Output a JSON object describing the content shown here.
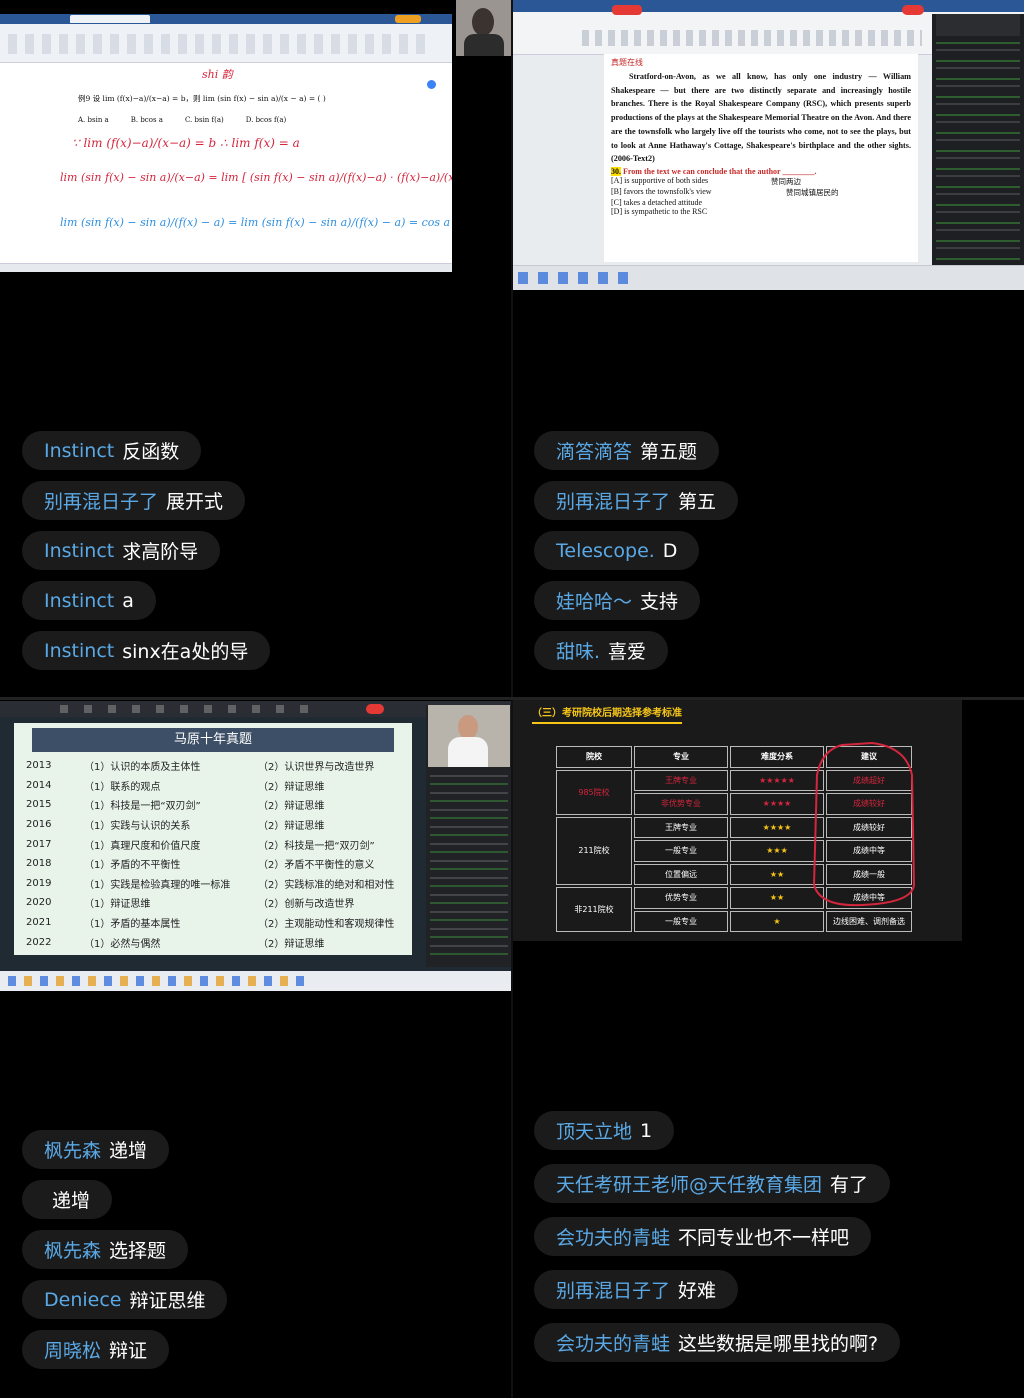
{
  "panels": [
    {
      "chat": [
        {
          "user": "Instinct",
          "msg": "反函数"
        },
        {
          "user": "别再混日子了",
          "msg": "展开式"
        },
        {
          "user": "Instinct",
          "msg": "求高阶导"
        },
        {
          "user": "Instinct",
          "msg": "a"
        },
        {
          "user": "Instinct",
          "msg": "sinx在a处的导"
        }
      ]
    },
    {
      "chat": [
        {
          "user": "滴答滴答",
          "msg": "第五题"
        },
        {
          "user": "别再混日子了",
          "msg": "第五"
        },
        {
          "user": "Telescope.",
          "msg": "D"
        },
        {
          "user": "娃哈哈～",
          "msg": "支持"
        },
        {
          "user": "甜味.",
          "msg": "喜爱"
        }
      ]
    },
    {
      "chat": [
        {
          "user": "枫先森",
          "msg": "递增"
        },
        {
          "user": "",
          "msg": "递增"
        },
        {
          "user": "枫先森",
          "msg": "选择题"
        },
        {
          "user": "Deniece",
          "msg": "辩证思维"
        },
        {
          "user": "周晓松",
          "msg": "辩证"
        }
      ]
    },
    {
      "chat": [
        {
          "user": "顶天立地",
          "msg": "1"
        },
        {
          "user": "天任考研王老师@天任教育集团",
          "msg": "有了"
        },
        {
          "user": "会功夫的青蛙",
          "msg": "不同专业也不一样吧"
        },
        {
          "user": "别再混日子了",
          "msg": "好难"
        },
        {
          "user": "会功夫的青蛙",
          "msg": "这些数据是哪里找的啊?"
        }
      ]
    }
  ],
  "math": {
    "problem": "例9 设 lim (f(x)−a)/(x−a) = b，则 lim (sin f(x) − sin a)/(x − a) = (   )",
    "options": [
      "A. bsin a",
      "B. bcos a",
      "C. bsin f(a)",
      "D. bcos f(a)"
    ],
    "ink_red": [
      "∵ lim (f(x)−a)/(x−a) = b  ∴ lim f(x) = a",
      "lim (sin f(x) − sin a)/(x−a) = lim [ (sin f(x) − sin a)/(f(x)−a) · (f(x)−a)/(x−a) ]"
    ],
    "ink_blue": [
      "lim (sin f(x) − sin a)/(f(x) − a) = lim (sin f(x) − sin a)/(f(x) − a) = cos a"
    ],
    "ink_note": "shi 韵"
  },
  "english": {
    "heading": "真题在线",
    "passage": "Stratford-on-Avon, as we all know, has only one industry — William Shakespeare — but there are two distinctly separate and increasingly hostile branches. There is the Royal Shakespeare Company (RSC), which presents superb productions of the plays at the Shakespeare Memorial Theatre on the Avon. And there are the townsfolk who largely live off the tourists who come, not to see the plays, but to look at Anne Hathaway's Cottage, Shakespeare's birthplace and the other sights. (2006-Text2)",
    "question_num": "30.",
    "question": "From the text we can conclude that the author ________.",
    "options": [
      "[A] is supportive of both sides",
      "[B] favors the townsfolk's view",
      "[C] takes a detached attitude",
      "[D] is sympathetic to the RSC"
    ],
    "notes": [
      "赞同两边",
      "赞同城镇居民的"
    ]
  },
  "tenyear": {
    "title": "马原十年真题",
    "rows": [
      {
        "year": "2013",
        "a": "（1）认识的本质及主体性",
        "b": "（2）认识世界与改造世界"
      },
      {
        "year": "2014",
        "a": "（1）联系的观点",
        "b": "（2）辩证思维"
      },
      {
        "year": "2015",
        "a": "（1）科技是一把“双刃剑”",
        "b": "（2）辩证思维"
      },
      {
        "year": "2016",
        "a": "（1）实践与认识的关系",
        "b": "（2）辩证思维"
      },
      {
        "year": "2017",
        "a": "（1）真理尺度和价值尺度",
        "b": "（2）科技是一把“双刃剑”"
      },
      {
        "year": "2018",
        "a": "（1）矛盾的不平衡性",
        "b": "（2）矛盾不平衡性的意义"
      },
      {
        "year": "2019",
        "a": "（1）实践是检验真理的唯一标准",
        "b": "（2）实践标准的绝对和相对性"
      },
      {
        "year": "2020",
        "a": "（1）辩证思维",
        "b": "（2）创新与改造世界"
      },
      {
        "year": "2021",
        "a": "（1）矛盾的基本属性",
        "b": "（2）主观能动性和客观规律性"
      },
      {
        "year": "2022",
        "a": "（1）必然与偶然",
        "b": "（2）辩证思维"
      }
    ]
  },
  "school": {
    "heading": "（三）考研院校后期选择参考标准",
    "headers": [
      "院校",
      "专业",
      "难度分系",
      "建议"
    ],
    "rows": [
      {
        "school": "985院校",
        "major": "王牌专业",
        "stars": "★★★★★",
        "advice": "成绩超好",
        "red": true,
        "school_span": 2
      },
      {
        "school": "",
        "major": "非优势专业",
        "stars": "★★★★",
        "advice": "成绩较好",
        "red": true,
        "school_span": 0
      },
      {
        "school": "211院校",
        "major": "王牌专业",
        "stars": "★★★★",
        "advice": "成绩较好",
        "red": false,
        "school_span": 3
      },
      {
        "school": "",
        "major": "一般专业",
        "stars": "★★★",
        "advice": "成绩中等",
        "red": false,
        "school_span": 0
      },
      {
        "school": "",
        "major": "位置偏远",
        "stars": "★★",
        "advice": "成绩一般",
        "red": false,
        "school_span": 0
      },
      {
        "school": "非211院校",
        "major": "优势专业",
        "stars": "★★",
        "advice": "成绩中等",
        "red": false,
        "school_span": 2
      },
      {
        "school": "",
        "major": "一般专业",
        "stars": "★",
        "advice": "边线困难、调剂备选",
        "red": false,
        "school_span": 0
      }
    ]
  },
  "colors": {
    "username": "#5aa9e6",
    "bubble": "#1b1b1b",
    "ink_red": "#d4263d",
    "ink_blue": "#2e8fe0"
  }
}
